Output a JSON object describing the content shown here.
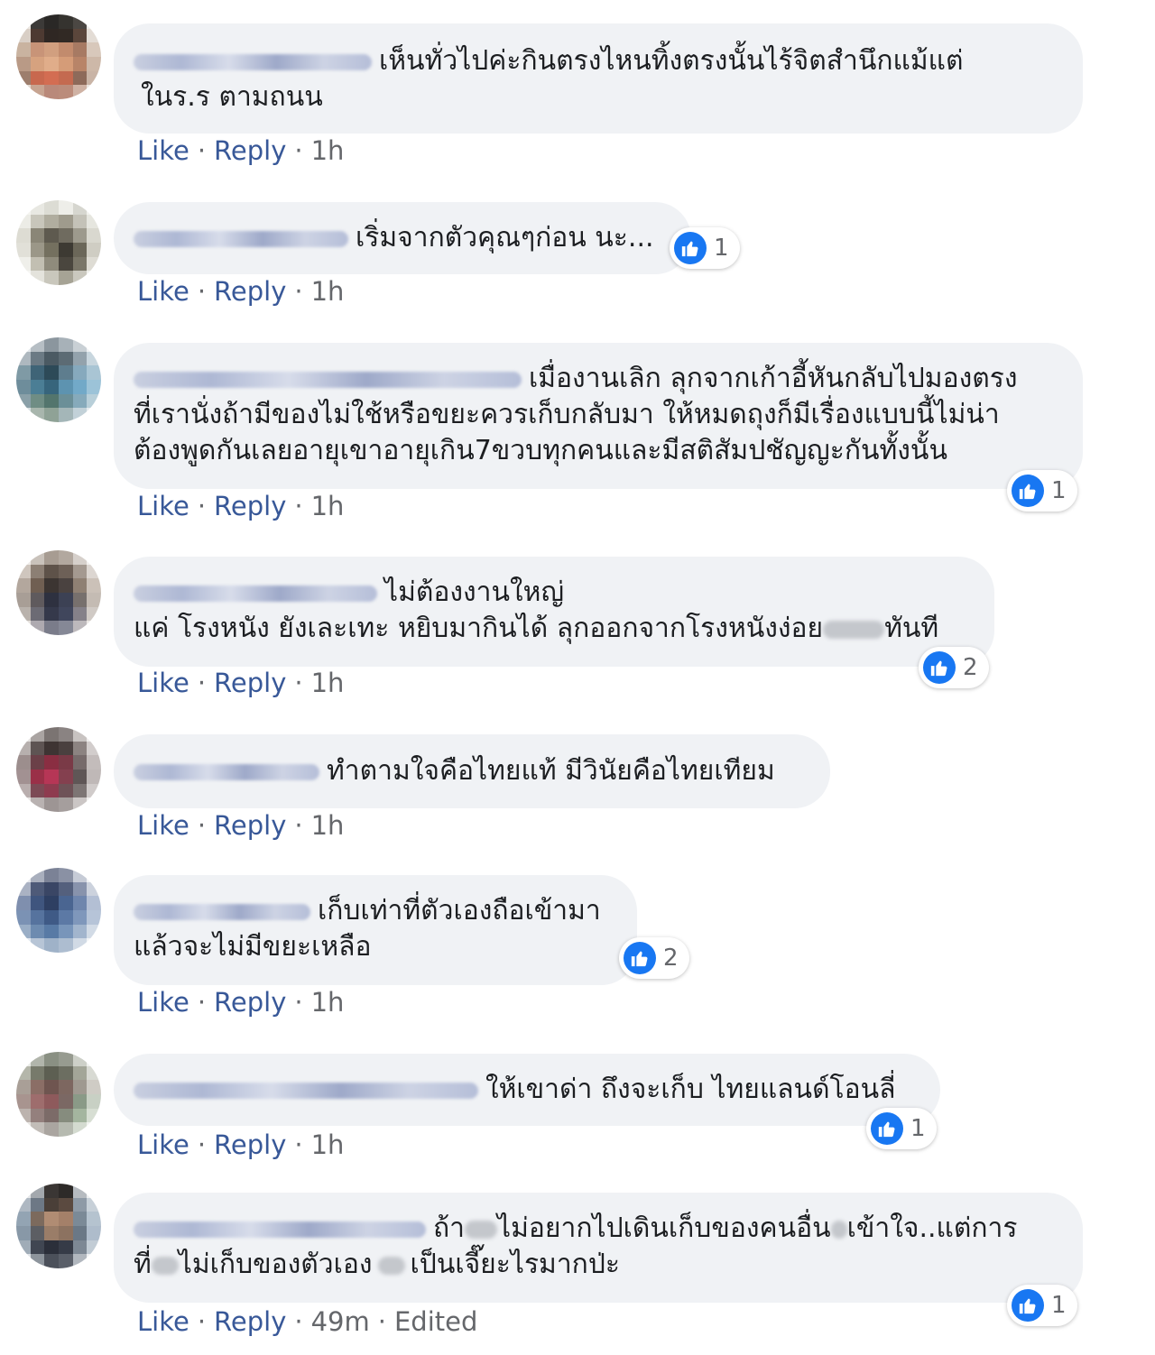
{
  "labels": {
    "like": "Like",
    "reply": "Reply",
    "separator": "·"
  },
  "comments": [
    {
      "author": "",
      "text_lines": [
        "เห็นทั่วไปค่ะกินตรงไหนทิ้งตรงนั้นไร้จิตสำนึกแม้แต่",
        "ในร.ร ตามถนน"
      ],
      "reactions": "",
      "time": "1h",
      "edited": ""
    },
    {
      "author": "",
      "text_lines": [
        "เริ่มจากตัวคุณๆก่อน นะ..."
      ],
      "reactions": "1",
      "time": "1h",
      "edited": ""
    },
    {
      "author": "",
      "text_lines": [
        "เมื่องานเลิก ลุกจากเก้าอี้หันกลับไปมองตรง",
        "ที่เรานั่งถ้ามีของไม่ใช้หรือขยะควรเก็บกลับมา ให้หมดถุงก็มีเรื่องแบบนี้ไม่น่า",
        "ต้องพูดกันเลยอายุเขาอายุเกิน7ขวบทุกคนและมีสติสัมปชัญญะกันทั้งนั้น"
      ],
      "reactions": "1",
      "time": "1h",
      "edited": ""
    },
    {
      "author": "",
      "text_lines": [
        "ไม่ต้องงานใหญ่",
        "แค่ โรงหนัง ยังเละเทะ หยิบมากินได้ ลุกออกจากโรงหนังง่อย",
        "ทันที"
      ],
      "reactions": "2",
      "time": "1h",
      "edited": ""
    },
    {
      "author": "",
      "text_lines": [
        "ทำตามใจคือไทยแท้ มีวินัยคือไทยเทียม"
      ],
      "reactions": "",
      "time": "1h",
      "edited": ""
    },
    {
      "author": "",
      "text_lines": [
        "เก็บเท่าที่ตัวเองถือเข้ามา",
        "แล้วจะไม่มีขยะเหลือ"
      ],
      "reactions": "2",
      "time": "1h",
      "edited": ""
    },
    {
      "author": "",
      "text_lines": [
        "ให้เขาด่า ถึงจะเก็บ ไทยแลนด์โอนลี่"
      ],
      "reactions": "1",
      "time": "1h",
      "edited": ""
    },
    {
      "author": "",
      "text_lines": [
        "ถ้า",
        "ไม่อยากไปเดินเก็บของคนอื่น",
        "เข้าใจ..แต่การ",
        "ที่",
        "ไม่เก็บของตัวเอง",
        "เป็นเจี๊ยะไรมากป่ะ"
      ],
      "reactions": "1",
      "time": "49m",
      "edited": "Edited"
    }
  ]
}
